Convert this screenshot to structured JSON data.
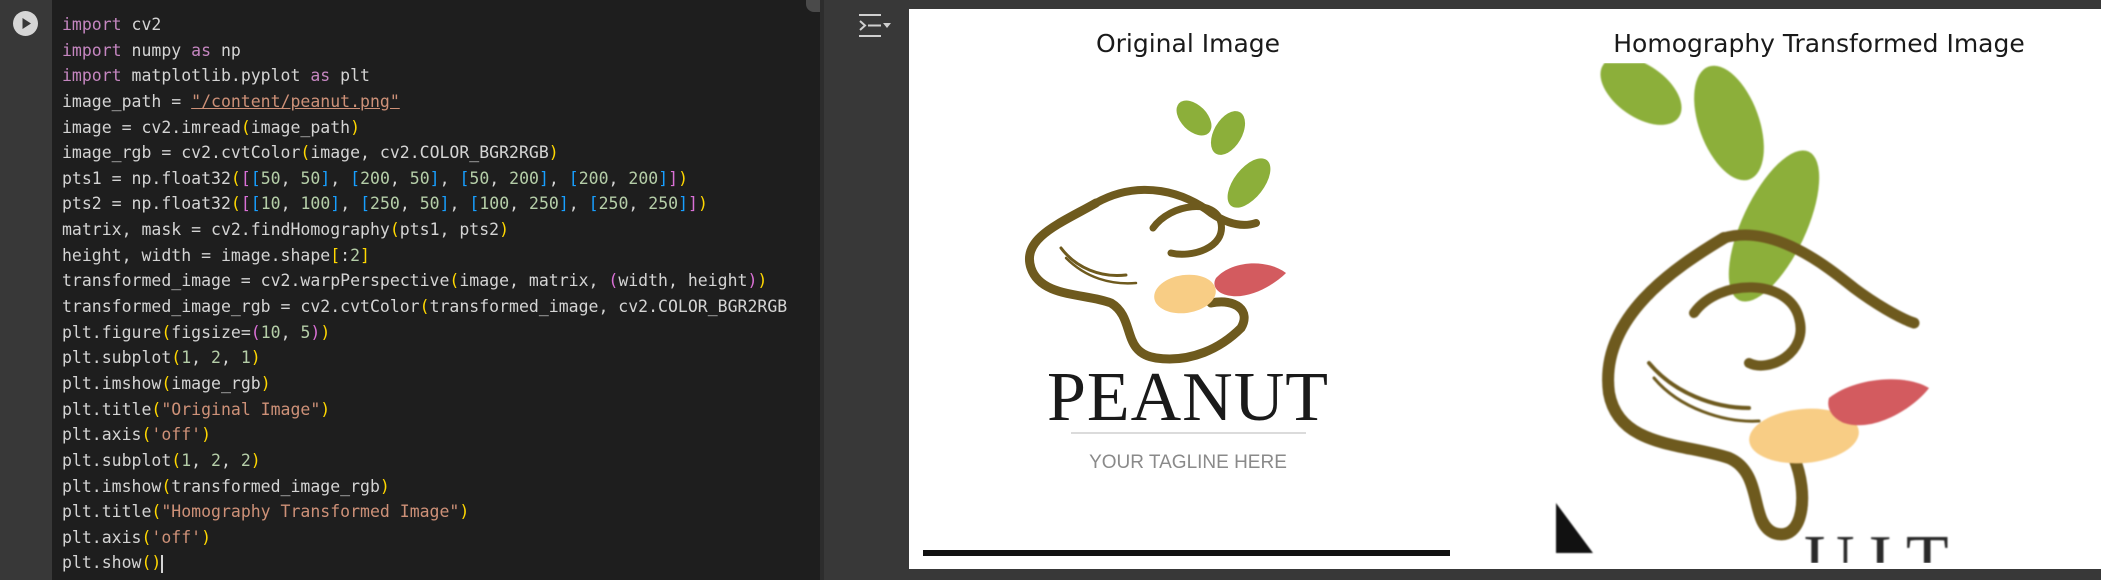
{
  "code_lines": [
    [
      {
        "t": "import",
        "c": "kw"
      },
      {
        "t": " cv2"
      }
    ],
    [
      {
        "t": "import",
        "c": "kw"
      },
      {
        "t": " numpy "
      },
      {
        "t": "as",
        "c": "kw"
      },
      {
        "t": " np"
      }
    ],
    [
      {
        "t": "import",
        "c": "kw"
      },
      {
        "t": " matplotlib.pyplot "
      },
      {
        "t": "as",
        "c": "kw"
      },
      {
        "t": " plt"
      }
    ],
    [
      {
        "t": "image_path = "
      },
      {
        "t": "\"/content/peanut.png\"",
        "c": "str str-ul"
      }
    ],
    [
      {
        "t": "image = cv2.imread"
      },
      {
        "t": "(",
        "c": "b1"
      },
      {
        "t": "image_path"
      },
      {
        "t": ")",
        "c": "b1"
      }
    ],
    [
      {
        "t": "image_rgb = cv2.cvtColor"
      },
      {
        "t": "(",
        "c": "b1"
      },
      {
        "t": "image, cv2.COLOR_BGR2RGB"
      },
      {
        "t": ")",
        "c": "b1"
      }
    ],
    [
      {
        "t": "pts1 = np.float32"
      },
      {
        "t": "(",
        "c": "b1"
      },
      {
        "t": "[",
        "c": "b2"
      },
      {
        "t": "[",
        "c": "b3"
      },
      {
        "t": "50",
        "c": "num"
      },
      {
        "t": ", "
      },
      {
        "t": "50",
        "c": "num"
      },
      {
        "t": "]",
        "c": "b3"
      },
      {
        "t": ", "
      },
      {
        "t": "[",
        "c": "b3"
      },
      {
        "t": "200",
        "c": "num"
      },
      {
        "t": ", "
      },
      {
        "t": "50",
        "c": "num"
      },
      {
        "t": "]",
        "c": "b3"
      },
      {
        "t": ", "
      },
      {
        "t": "[",
        "c": "b3"
      },
      {
        "t": "50",
        "c": "num"
      },
      {
        "t": ", "
      },
      {
        "t": "200",
        "c": "num"
      },
      {
        "t": "]",
        "c": "b3"
      },
      {
        "t": ", "
      },
      {
        "t": "[",
        "c": "b3"
      },
      {
        "t": "200",
        "c": "num"
      },
      {
        "t": ", "
      },
      {
        "t": "200",
        "c": "num"
      },
      {
        "t": "]",
        "c": "b3"
      },
      {
        "t": "]",
        "c": "b2"
      },
      {
        "t": ")",
        "c": "b1"
      }
    ],
    [
      {
        "t": "pts2 = np.float32"
      },
      {
        "t": "(",
        "c": "b1"
      },
      {
        "t": "[",
        "c": "b2"
      },
      {
        "t": "[",
        "c": "b3"
      },
      {
        "t": "10",
        "c": "num"
      },
      {
        "t": ", "
      },
      {
        "t": "100",
        "c": "num"
      },
      {
        "t": "]",
        "c": "b3"
      },
      {
        "t": ", "
      },
      {
        "t": "[",
        "c": "b3"
      },
      {
        "t": "250",
        "c": "num"
      },
      {
        "t": ", "
      },
      {
        "t": "50",
        "c": "num"
      },
      {
        "t": "]",
        "c": "b3"
      },
      {
        "t": ", "
      },
      {
        "t": "[",
        "c": "b3"
      },
      {
        "t": "100",
        "c": "num"
      },
      {
        "t": ", "
      },
      {
        "t": "250",
        "c": "num"
      },
      {
        "t": "]",
        "c": "b3"
      },
      {
        "t": ", "
      },
      {
        "t": "[",
        "c": "b3"
      },
      {
        "t": "250",
        "c": "num"
      },
      {
        "t": ", "
      },
      {
        "t": "250",
        "c": "num"
      },
      {
        "t": "]",
        "c": "b3"
      },
      {
        "t": "]",
        "c": "b2"
      },
      {
        "t": ")",
        "c": "b1"
      }
    ],
    [
      {
        "t": "matrix, mask = cv2.findHomography"
      },
      {
        "t": "(",
        "c": "b1"
      },
      {
        "t": "pts1, pts2"
      },
      {
        "t": ")",
        "c": "b1"
      }
    ],
    [
      {
        "t": "height, width = image.shape"
      },
      {
        "t": "[",
        "c": "b1"
      },
      {
        "t": ":"
      },
      {
        "t": "2",
        "c": "num"
      },
      {
        "t": "]",
        "c": "b1"
      }
    ],
    [
      {
        "t": "transformed_image = cv2.warpPerspective"
      },
      {
        "t": "(",
        "c": "b1"
      },
      {
        "t": "image, matrix, "
      },
      {
        "t": "(",
        "c": "b2"
      },
      {
        "t": "width, height"
      },
      {
        "t": ")",
        "c": "b2"
      },
      {
        "t": ")",
        "c": "b1"
      }
    ],
    [
      {
        "t": "transformed_image_rgb = cv2.cvtColor"
      },
      {
        "t": "(",
        "c": "b1"
      },
      {
        "t": "transformed_image, cv2.COLOR_BGR2RGB"
      }
    ],
    [
      {
        "t": "plt.figure"
      },
      {
        "t": "(",
        "c": "b1"
      },
      {
        "t": "figsize="
      },
      {
        "t": "(",
        "c": "b2"
      },
      {
        "t": "10",
        "c": "num"
      },
      {
        "t": ", "
      },
      {
        "t": "5",
        "c": "num"
      },
      {
        "t": ")",
        "c": "b2"
      },
      {
        "t": ")",
        "c": "b1"
      }
    ],
    [
      {
        "t": "plt.subplot"
      },
      {
        "t": "(",
        "c": "b1"
      },
      {
        "t": "1",
        "c": "num"
      },
      {
        "t": ", "
      },
      {
        "t": "2",
        "c": "num"
      },
      {
        "t": ", "
      },
      {
        "t": "1",
        "c": "num"
      },
      {
        "t": ")",
        "c": "b1"
      }
    ],
    [
      {
        "t": "plt.imshow"
      },
      {
        "t": "(",
        "c": "b1"
      },
      {
        "t": "image_rgb"
      },
      {
        "t": ")",
        "c": "b1"
      }
    ],
    [
      {
        "t": "plt.title"
      },
      {
        "t": "(",
        "c": "b1"
      },
      {
        "t": "\"Original Image\"",
        "c": "str"
      },
      {
        "t": ")",
        "c": "b1"
      }
    ],
    [
      {
        "t": "plt.axis"
      },
      {
        "t": "(",
        "c": "b1"
      },
      {
        "t": "'off'",
        "c": "str"
      },
      {
        "t": ")",
        "c": "b1"
      }
    ],
    [
      {
        "t": "plt.subplot"
      },
      {
        "t": "(",
        "c": "b1"
      },
      {
        "t": "1",
        "c": "num"
      },
      {
        "t": ", "
      },
      {
        "t": "2",
        "c": "num"
      },
      {
        "t": ", "
      },
      {
        "t": "2",
        "c": "num"
      },
      {
        "t": ")",
        "c": "b1"
      }
    ],
    [
      {
        "t": "plt.imshow"
      },
      {
        "t": "(",
        "c": "b1"
      },
      {
        "t": "transformed_image_rgb"
      },
      {
        "t": ")",
        "c": "b1"
      }
    ],
    [
      {
        "t": "plt.title"
      },
      {
        "t": "(",
        "c": "b1"
      },
      {
        "t": "\"Homography Transformed Image\"",
        "c": "str"
      },
      {
        "t": ")",
        "c": "b1"
      }
    ],
    [
      {
        "t": "plt.axis"
      },
      {
        "t": "(",
        "c": "b1"
      },
      {
        "t": "'off'",
        "c": "str"
      },
      {
        "t": ")",
        "c": "b1"
      }
    ],
    [
      {
        "t": "plt.show"
      },
      {
        "t": "(",
        "c": "b1"
      },
      {
        "t": ")",
        "c": "b1"
      },
      {
        "t": "",
        "c": "cursor"
      }
    ]
  ],
  "output": {
    "left_title": "Original Image",
    "right_title": "Homography Transformed Image",
    "logo_word": "PEANUT",
    "logo_tagline": "YOUR TAGLINE HERE",
    "transformed_partial_text": "UIT"
  },
  "icons": {
    "run": "play-circle-icon",
    "output_toggle": "output-collapse-icon"
  },
  "colors": {
    "code_bg": "#1e1e1e",
    "gutter_bg": "#383838",
    "keyword": "#c586c0",
    "string": "#ce9178",
    "number": "#b5cea8",
    "bracket1": "#ffd700",
    "bracket2": "#da70d6",
    "bracket3": "#179fff",
    "leaf_green": "#8caf3a",
    "peanut_outline": "#6e5a1e",
    "peach": "#f8cd85",
    "red": "#d35b5f"
  }
}
